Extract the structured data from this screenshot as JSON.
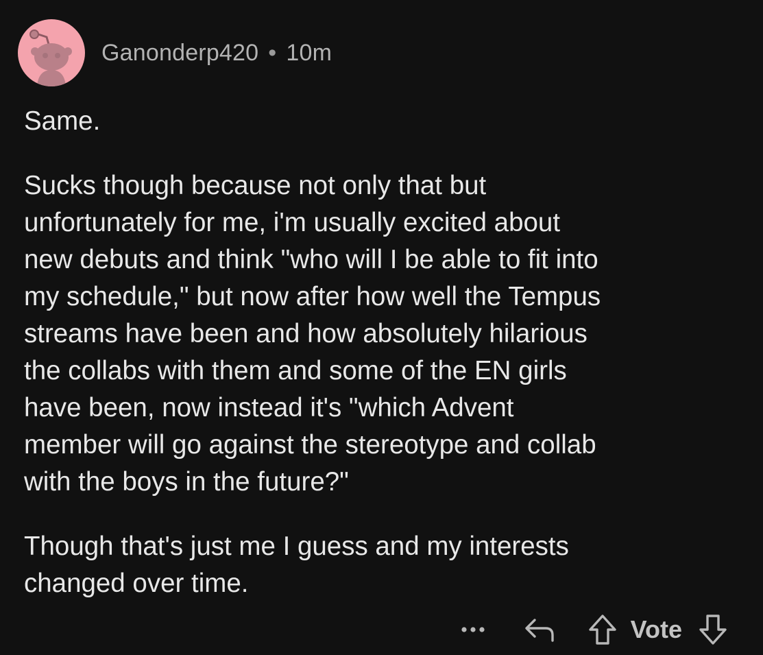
{
  "comment": {
    "username": "Ganonderp420",
    "separator": "•",
    "timestamp": "10m",
    "avatar_color": "#f4a3ad",
    "avatar_icon": "reddit-snoo-avatar-icon",
    "paragraphs": [
      "Same.",
      "Sucks though because not only that but\nunfortunately for me, i'm usually excited about\nnew debuts and think \"who will I be able to fit into\nmy schedule,\" but now after how well the Tempus\nstreams have been and how absolutely hilarious\nthe collabs with them and some of the EN girls\nhave been, now instead it's \"which Advent\nmember will go against the stereotype and collab\nwith the boys in the future?\"",
      "Though that's just me I guess and my interests\nchanged over time."
    ]
  },
  "actions": {
    "more_icon": "more-dots-icon",
    "reply_icon": "reply-arrow-icon",
    "upvote_icon": "upvote-arrow-icon",
    "vote_label": "Vote",
    "downvote_icon": "downvote-arrow-icon"
  }
}
